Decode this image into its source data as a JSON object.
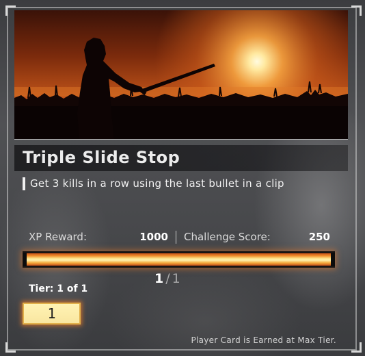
{
  "challenge": {
    "title": "Triple Slide Stop",
    "description": "Get 3 kills in a row using the last bullet in a clip",
    "image_icon": "samurai-sunset-image"
  },
  "rewards": {
    "xp_label": "XP Reward:",
    "xp_value": "1000",
    "score_label": "Challenge Score:",
    "score_value": "250"
  },
  "progress": {
    "current": "1",
    "separator": "/",
    "total": "1",
    "fraction": 1.0
  },
  "tier": {
    "label": "Tier: 1 of 1",
    "box_value": "1"
  },
  "footer": {
    "note": "Player Card is Earned at Max Tier."
  },
  "colors": {
    "accent_orange": "#f08c2a",
    "tier_box": "#fff3b4",
    "glow": "#e6782a"
  }
}
